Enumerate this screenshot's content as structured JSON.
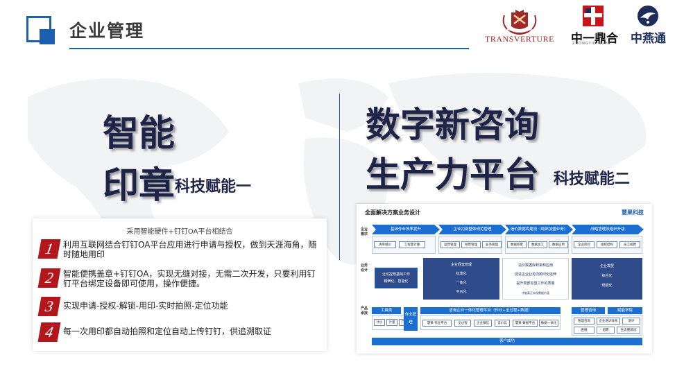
{
  "header": {
    "title": "企业管理",
    "logos": {
      "transverture": "TRANSVERTURE",
      "zhongyi": "中一鼎合",
      "zhongyi_sub": "ZHONGYIDINGHE",
      "zhongyantong": "中燕通"
    }
  },
  "left": {
    "headline_line1": "智能",
    "headline_line2": "印章",
    "subtitle": "科技赋能一",
    "card": {
      "heading": "采用智能硬件+钉钉OA平台相结合",
      "items": [
        {
          "num": "1",
          "text": "利用互联网结合钉钉OA平台应用进行申请与授权，做到天涯海角，随时随地用印"
        },
        {
          "num": "2",
          "text": "智能便携盖章+钉钉OA，实现无缝对接，无需二次开发，只要利用钉钉平台绑定设备即可使用，操作便捷。"
        },
        {
          "num": "3",
          "text": "实现申请-授权-解锁-用印-实时拍照-定位功能"
        },
        {
          "num": "4",
          "text": "每一次用印都自动拍照和定位自动上传钉钉，供追溯取证"
        }
      ]
    }
  },
  "right": {
    "headline_line1": "数字新咨询",
    "headline_line2": "生产力平台",
    "subtitle": "科技赋能二",
    "diagram": {
      "title": "全面解决方案业务设计",
      "brand": "慧果科技",
      "side_labels": [
        "企业需求",
        "业务设计",
        "产品承接"
      ],
      "phases": [
        "基础作业效率提升",
        "企业内部整体规范管理",
        "造价数据库建设（局部加盟业务）",
        "战略管理及组织升级"
      ],
      "phase_chips": [
        [
          "清单组价",
          "工程量计算"
        ],
        [
          "运营管理",
          "经营管理",
          "业务管理"
        ],
        [
          "数据积累",
          "数据加工",
          "数据应用"
        ],
        [
          "企业风控",
          "组织结构",
          "员工招聘"
        ]
      ],
      "design_blocks": [
        [
          "让可控规基础工作",
          "精细化、智能化"
        ],
        [
          "企业经营管理",
          "标准化",
          "一体化",
          "平台化"
        ],
        [
          "造价数据库积累和应用",
          "促进企业业务向顾问化延伸",
          "提升局部加盟工作的质量",
          "才能真正实现数据价值"
        ],
        [
          "企业发展",
          "综合化",
          "规模化"
        ]
      ],
      "tools_label": "工具类",
      "tools": [
        "计价",
        "计量",
        "广材"
      ],
      "ops_label": "作业管理",
      "platform_label": "咨询企业一体化管理平台（作业+全过程+数据）",
      "platform_chips": [
        "慧果-作业平台",
        "全过程",
        "企业微信",
        "造价云",
        "慧果-数据平台",
        "数据一体化"
      ],
      "mgmt_label": "管理咨询",
      "edu_label": "赋能学院",
      "mgmt_chips": [
        "管理咨询",
        "企业培训体系",
        "测评",
        "金融",
        "招聘",
        "生态圈建设"
      ],
      "footer": "客户成功"
    }
  }
}
